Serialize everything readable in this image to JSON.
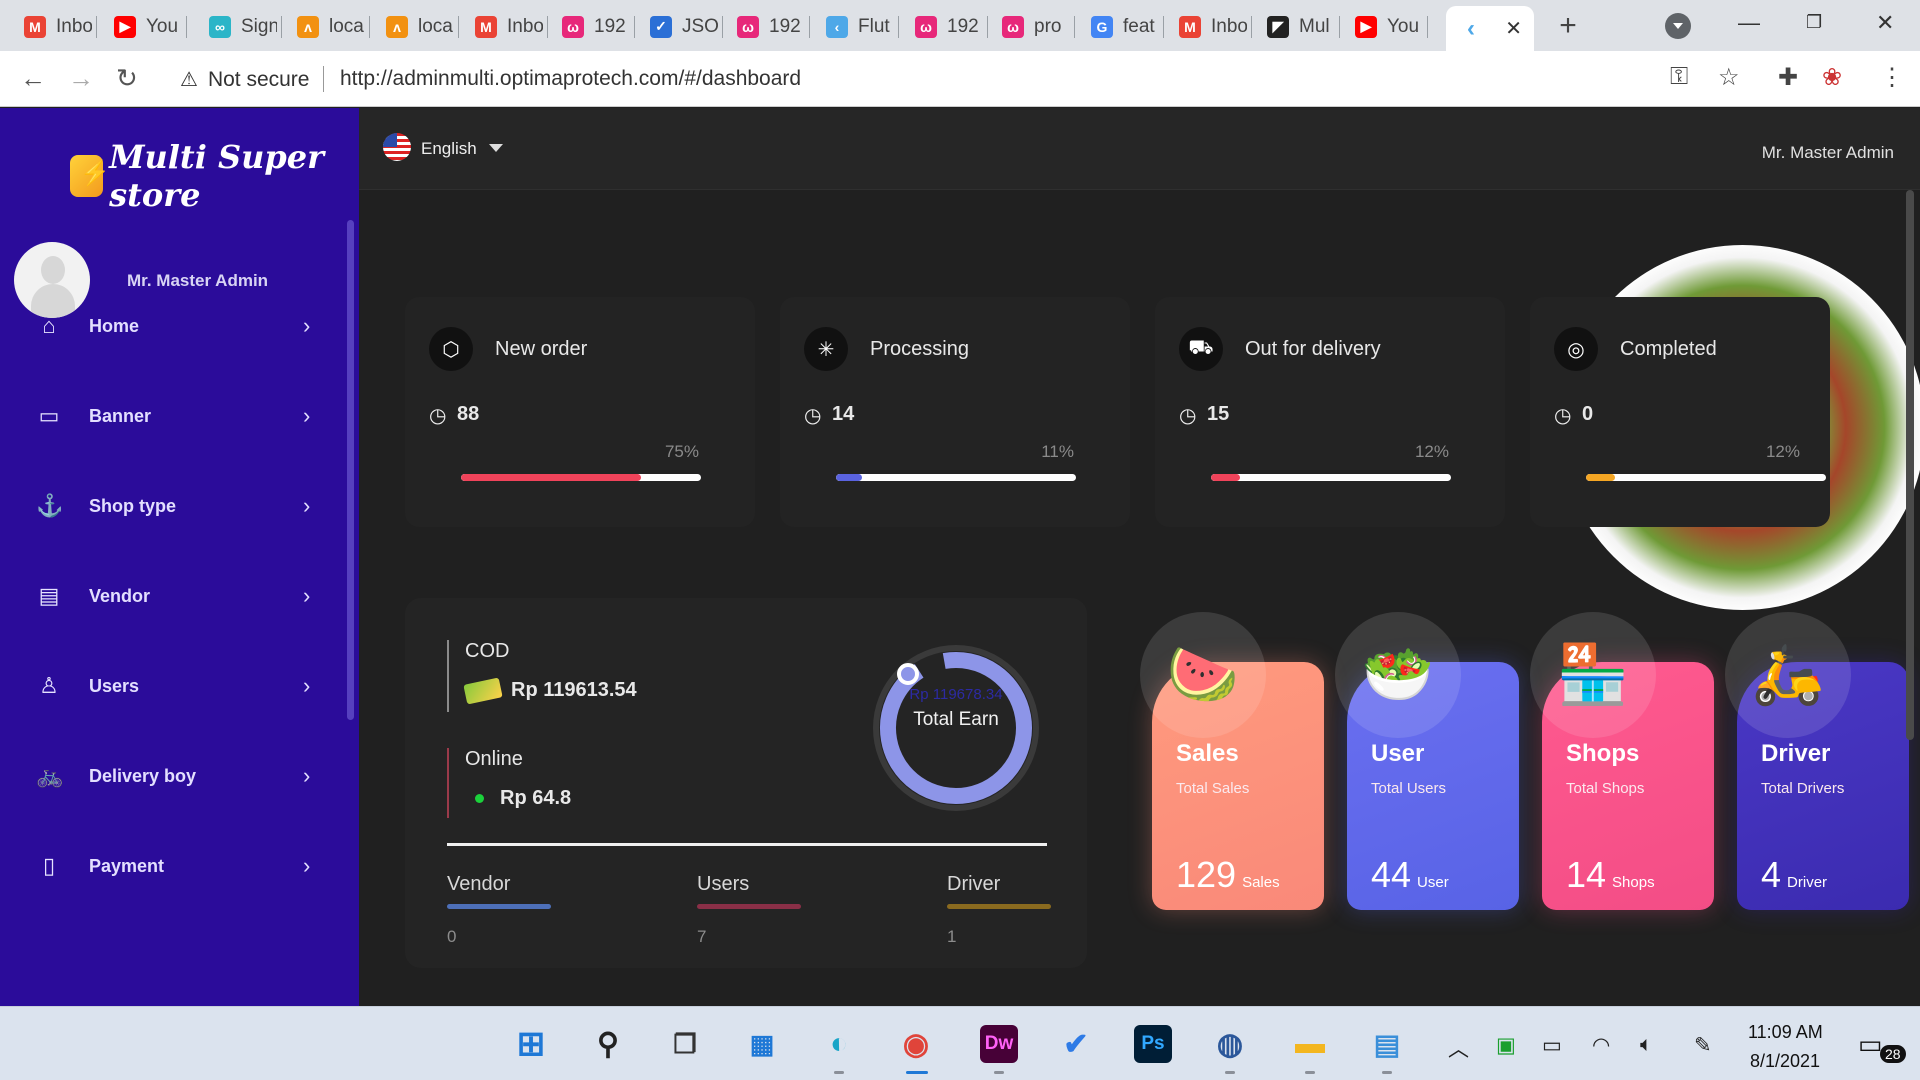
{
  "browser": {
    "tabs": [
      {
        "label": "Inbo",
        "icon": "gmail-icon",
        "color": "#ea4335",
        "glyph": "M"
      },
      {
        "label": "You",
        "icon": "youtube-icon",
        "color": "#ff0000",
        "glyph": "▶"
      },
      {
        "label": "Sign",
        "icon": "sign-icon",
        "color": "#2bb5c8",
        "glyph": "∞"
      },
      {
        "label": "loca",
        "icon": "phpmyadmin-icon",
        "color": "#f29111",
        "glyph": "ᴧ"
      },
      {
        "label": "loca",
        "icon": "phpmyadmin-icon",
        "color": "#f29111",
        "glyph": "ᴧ"
      },
      {
        "label": "Inbo",
        "icon": "gmail-icon",
        "color": "#ea4335",
        "glyph": "M"
      },
      {
        "label": "192",
        "icon": "app-icon",
        "color": "#e7287a",
        "glyph": "ω"
      },
      {
        "label": "JSO",
        "icon": "check-icon",
        "color": "#2b6fd6",
        "glyph": "✓"
      },
      {
        "label": "192",
        "icon": "app-icon",
        "color": "#e7287a",
        "glyph": "ω"
      },
      {
        "label": "Flut",
        "icon": "flutter-icon",
        "color": "#4ea8e8",
        "glyph": "‹"
      },
      {
        "label": "192",
        "icon": "app-icon",
        "color": "#e7287a",
        "glyph": "ω"
      },
      {
        "label": "pro",
        "icon": "app-icon",
        "color": "#e7287a",
        "glyph": "ω"
      },
      {
        "label": "feat",
        "icon": "google-icon",
        "color": "#4285f4",
        "glyph": "G"
      },
      {
        "label": "Inbo",
        "icon": "gmail-icon",
        "color": "#ea4335",
        "glyph": "M"
      },
      {
        "label": "Mul",
        "icon": "app-icon",
        "color": "#222222",
        "glyph": "◤"
      },
      {
        "label": "You",
        "icon": "youtube-icon",
        "color": "#ff0000",
        "glyph": "▶"
      }
    ],
    "security": "Not secure",
    "url": "http://adminmulti.optimaprotech.com/#/dashboard"
  },
  "sidebar": {
    "brand": "Multi Super store",
    "admin_name": "Mr. Master Admin",
    "items": [
      {
        "label": "Home",
        "icon": "home-icon",
        "glyph": "⌂"
      },
      {
        "label": "Banner",
        "icon": "monitor-icon",
        "glyph": "▭"
      },
      {
        "label": "Shop type",
        "icon": "anchor-icon",
        "glyph": "⚓"
      },
      {
        "label": "Vendor",
        "icon": "store-icon",
        "glyph": "▤"
      },
      {
        "label": "Users",
        "icon": "user-icon",
        "glyph": "♙"
      },
      {
        "label": "Delivery boy",
        "icon": "bicycle-icon",
        "glyph": "🚲"
      },
      {
        "label": "Payment",
        "icon": "document-icon",
        "glyph": "▯"
      }
    ]
  },
  "topbar": {
    "language": "English",
    "admin_name": "Mr. Master Admin"
  },
  "stats": [
    {
      "title": "New order",
      "icon": "box-icon",
      "glyph": "⬡",
      "count": "88",
      "percent_label": "75%",
      "percent": 0.75,
      "color": "#f0435a"
    },
    {
      "title": "Processing",
      "icon": "loader-icon",
      "glyph": "✳",
      "count": "14",
      "percent_label": "11%",
      "percent": 0.11,
      "color": "#5a63e0"
    },
    {
      "title": "Out for delivery",
      "icon": "motorbike-icon",
      "glyph": "⛟",
      "count": "15",
      "percent_label": "12%",
      "percent": 0.12,
      "color": "#f0435a"
    },
    {
      "title": "Completed",
      "icon": "fingerprint-icon",
      "glyph": "◎",
      "count": "0",
      "percent_label": "12%",
      "percent": 0.12,
      "color": "#f5a623"
    }
  ],
  "earnings": {
    "cod_label": "COD",
    "cod_amount": "Rp 119613.54",
    "online_label": "Online",
    "online_amount": "Rp 64.8",
    "total_value": "Rp 119678.34",
    "total_label": "Total Earn",
    "mini": [
      {
        "label": "Vendor",
        "value": "0",
        "color": "#4d6fb8"
      },
      {
        "label": "Users",
        "value": "7",
        "color": "#8a2f47"
      },
      {
        "label": "Driver",
        "value": "1",
        "color": "#8a6a1f"
      }
    ]
  },
  "kpis": [
    {
      "title": "Sales",
      "sub": "Total Sales",
      "num": "129",
      "unit": "Sales",
      "icon": "watermelon-icon",
      "glyph": "🍉",
      "bg": "#f98979",
      "bg2": "#ff9a7e"
    },
    {
      "title": "User",
      "sub": "Total Users",
      "num": "44",
      "unit": "User",
      "icon": "bowl-icon",
      "glyph": "🥗",
      "bg": "#5863e6",
      "bg2": "#6a6ff0"
    },
    {
      "title": "Shops",
      "sub": "Total Shops",
      "num": "14",
      "unit": "Shops",
      "icon": "shop-icon",
      "glyph": "🏪",
      "bg": "#f34d86",
      "bg2": "#ff5a8f"
    },
    {
      "title": "Driver",
      "sub": "Total Drivers",
      "num": "4",
      "unit": "Driver",
      "icon": "scooter-icon",
      "glyph": "🛵",
      "bg": "#3b2bb0",
      "bg2": "#4a38c5"
    }
  ],
  "taskbar": {
    "time": "11:09 AM",
    "date": "8/1/2021",
    "notifications": "28"
  }
}
